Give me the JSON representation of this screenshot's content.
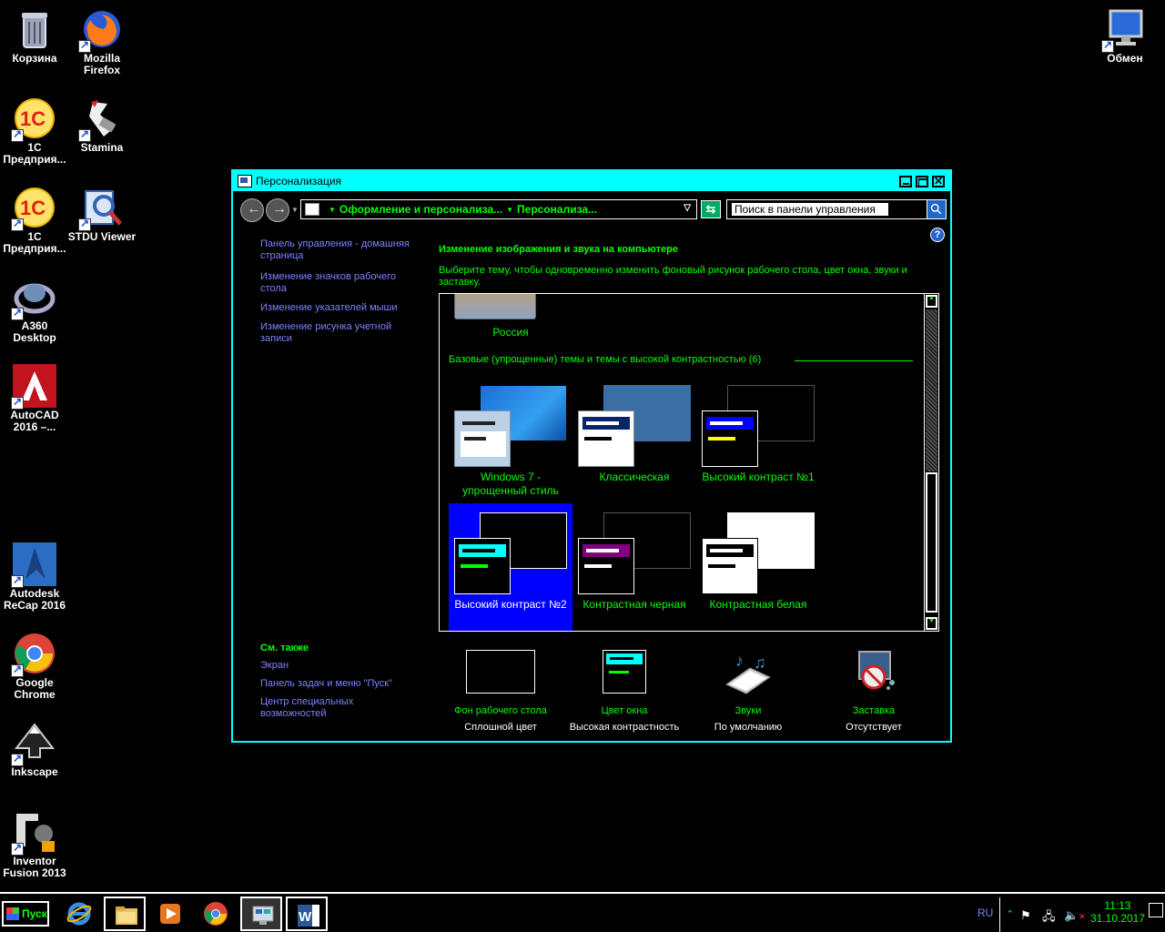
{
  "desktop": {
    "icons": [
      {
        "label": "Корзина"
      },
      {
        "label": "Mozilla Firefox"
      },
      {
        "label": "1C Предприя..."
      },
      {
        "label": "Stamina"
      },
      {
        "label": "1C Предприя..."
      },
      {
        "label": "STDU Viewer"
      },
      {
        "label": "A360 Desktop"
      },
      {
        "label": "AutoCAD 2016 –..."
      },
      {
        "label": "Autodesk ReCap 2016"
      },
      {
        "label": "Google Chrome"
      },
      {
        "label": "Inkscape"
      },
      {
        "label": "Inventor Fusion 2013"
      },
      {
        "label": "Обмен"
      }
    ]
  },
  "window": {
    "title": "Персонализация",
    "breadcrumb": [
      "Оформление и персонализа...",
      "Персонализа..."
    ],
    "search_placeholder": "Поиск в панели управления",
    "help": "?"
  },
  "left_pane": {
    "links": [
      "Панель управления - домашняя страница",
      "Изменение значков рабочего стола",
      "Изменение указателей мыши",
      "Изменение рисунка учетной записи"
    ],
    "see_also_header": "См. также",
    "see_also": [
      "Экран",
      "Панель задач и меню \"Пуск\"",
      "Центр специальных возможностей"
    ]
  },
  "main": {
    "heading": "Изменение изображения и звука на компьютере",
    "subheading": "Выберите тему, чтобы одновременно изменить фоновый рисунок рабочего стола, цвет окна, звуки и заставку.",
    "russia_label": "Россия",
    "group_header": "Базовые (упрощенные) темы и темы с высокой контрастностью (6)",
    "themes": [
      {
        "label": "Windows 7 - упрощенный стиль",
        "selected": false
      },
      {
        "label": "Классическая",
        "selected": false
      },
      {
        "label": "Высокий контраст №1",
        "selected": false
      },
      {
        "label": "Высокий контраст №2",
        "selected": true
      },
      {
        "label": "Контрастная черная",
        "selected": false
      },
      {
        "label": "Контрастная белая",
        "selected": false
      }
    ]
  },
  "settings": [
    {
      "name": "Фон рабочего стола",
      "value": "Сплошной цвет"
    },
    {
      "name": "Цвет окна",
      "value": "Высокая контрастность"
    },
    {
      "name": "Звуки",
      "value": "По умолчанию"
    },
    {
      "name": "Заставка",
      "value": "Отсутствует"
    }
  ],
  "taskbar": {
    "start_label": "Пуск",
    "lang": "RU",
    "time": "11:13",
    "date": "31.10.2017"
  },
  "colors": {
    "accent": "#00ffff",
    "text_green": "#00ff00",
    "link": "#8080ff",
    "selected": "#0000ff"
  }
}
